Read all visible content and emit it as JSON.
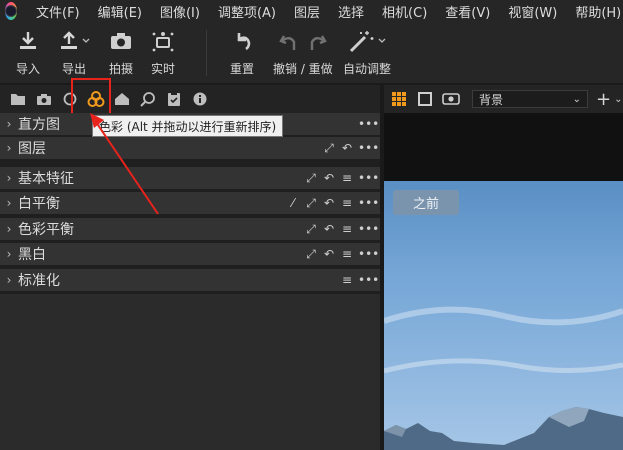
{
  "menu": [
    "文件(F)",
    "编辑(E)",
    "图像(I)",
    "调整项(A)",
    "图层",
    "选择",
    "相机(C)",
    "查看(V)",
    "视窗(W)",
    "帮助(H)"
  ],
  "toolbar": {
    "import": "导入",
    "export": "导出",
    "capture": "拍摄",
    "live": "实时",
    "reset": "重置",
    "undo_redo": "撤销 / 重做",
    "auto_adjust": "自动调整"
  },
  "tooltip": "色彩 (Alt 并拖动以进行重新排序)",
  "tools": [
    {
      "title": "直方图"
    },
    {
      "title": "图层"
    },
    {
      "title": "基本特征"
    },
    {
      "title": "白平衡"
    },
    {
      "title": "色彩平衡"
    },
    {
      "title": "黑白"
    },
    {
      "title": "标准化"
    }
  ],
  "viewer": {
    "variant": "背景",
    "before_label": "之前"
  },
  "colors": {
    "accent": "#f29a1e",
    "highlight": "#e8231c"
  }
}
